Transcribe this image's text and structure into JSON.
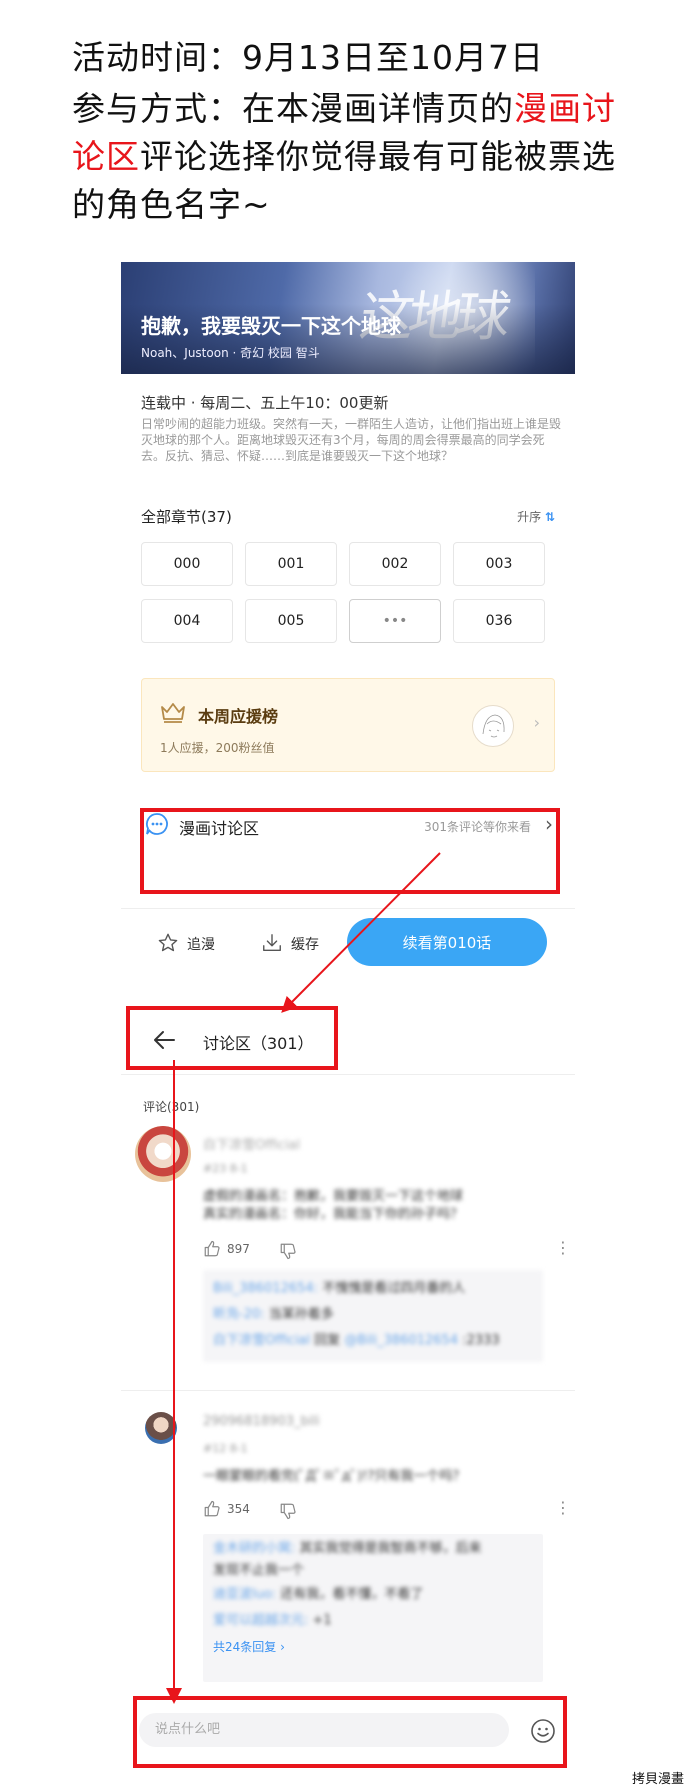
{
  "heading": {
    "line1": "活动时间：9月13日至10月7日",
    "line2_prefix": "参与方式：在本漫画详情页的",
    "line2_red": "漫画讨",
    "line3_red": "论区",
    "line3_rest": "评论选择你觉得最有可能被票选",
    "line4": "的角色名字~"
  },
  "comic": {
    "banner_title": "抱歉，我要毁灭一下这个地球",
    "banner_art_text": "这地球",
    "banner_meta": "Noah、Justoon · 奇幻   校园   智斗",
    "status": "连载中 · 每周二、五上午10：00更新",
    "description": "日常吵闹的超能力班级。突然有一天，一群陌生人造访，让他们指出班上谁是毁灭地球的那个人。距离地球毁灭还有3个月，每周的周会得票最高的同学会死去。反抗、猜忌、怀疑……到底是谁要毁灭一下这个地球？",
    "chapters_header": "全部章节(37)",
    "sort_label": "升序",
    "chapters": [
      "000",
      "001",
      "002",
      "003",
      "004",
      "005",
      "•••",
      "036"
    ],
    "support_title": "本周应援榜",
    "support_sub": "1人应援，200粉丝值",
    "discussion_label": "漫画讨论区",
    "discussion_hint": "301条评论等你来看",
    "follow_label": "追漫",
    "download_label": "缓存",
    "read_button": "续看第010话"
  },
  "discussion": {
    "title": "讨论区（301）",
    "comment_count": "评论(301)",
    "comments": [
      {
        "user": "白下凉雪Official",
        "meta": "#23  8-1",
        "text_line1": "虚假的漫画名：抱歉，我要毁灭一下这个地球",
        "text_line2": "真实的漫画名：你好，我能当下你的孙子吗？",
        "likes": "897",
        "replies": [
          {
            "user": "Bili_386012654:",
            "text": " 不愧愧是看过四月番的人"
          },
          {
            "user": "昕凫-20:",
            "text": " 当某孙着多"
          },
          {
            "user": "白下凉雪Official",
            "text": " 回复 ",
            "user2": "@Bili_386012654",
            "text2": " :2333"
          }
        ]
      },
      {
        "user": "29096818903_bili",
        "meta": "#12  8-1",
        "text_line1": "一眼蒙眼的看完(ﾟДﾟ≡ﾟдﾟ)!?只有我一个吗？",
        "likes": "354",
        "replies": [
          {
            "user": "金木研的小窝:",
            "text": " 其实我觉得是我智商不够，后来"
          },
          {
            "user": "",
            "text": "发现不止我一个"
          },
          {
            "user": "迪亚波luo:",
            "text": " 还有我，看不懂，不看了"
          },
          {
            "user": "爱可以超越次元:",
            "text": " +1"
          }
        ],
        "more_replies": "共24条回复"
      }
    ],
    "input_placeholder": "说点什么吧"
  },
  "watermark": "拷貝漫畫",
  "colors": {
    "accent": "#3aa6f5",
    "highlight": "#e8151b"
  }
}
